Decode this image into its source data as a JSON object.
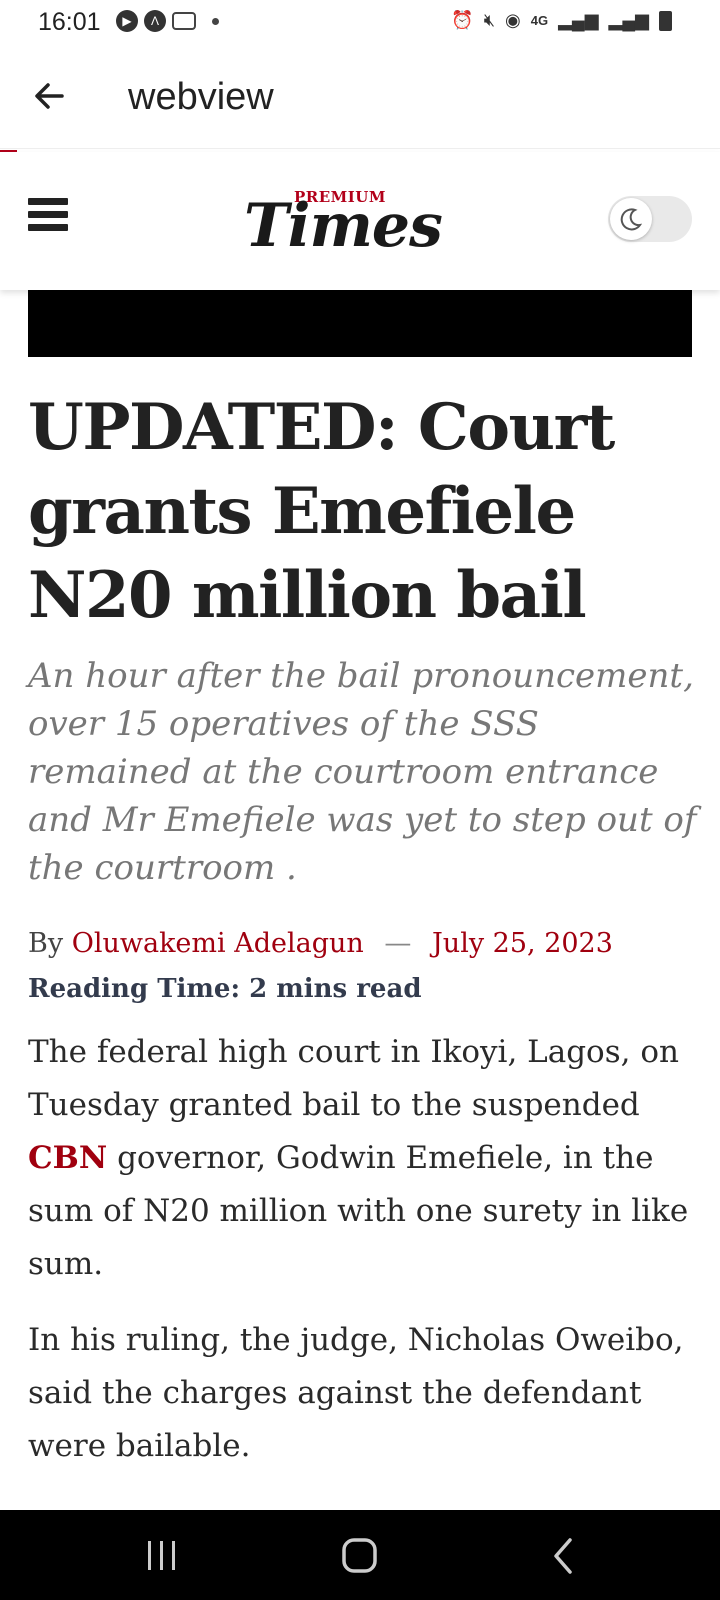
{
  "status_bar": {
    "time": "16:01",
    "network": "4G"
  },
  "app_bar": {
    "title": "webview"
  },
  "site": {
    "logo_premium": "PREMIUM",
    "logo_times": "Times"
  },
  "article": {
    "headline": "UPDATED: Court grants Emefiele N20 million bail",
    "excerpt": "An hour after the bail pronouncement, over 15 operatives of the SSS remained at the courtroom entrance and Mr Emefiele was yet to step out of the courtroom .",
    "byline_prefix": "By",
    "author": "Oluwakemi Adelagun",
    "separator": "—",
    "date": "July 25, 2023",
    "reading_time": "Reading Time: 2 mins read",
    "p1_before": "The federal high court in Ikoyi, Lagos, on Tuesday granted bail to the suspended ",
    "p1_link": "CBN",
    "p1_after": " governor, Godwin Emefiele, in the sum of N20 million with one surety in like sum.",
    "p2": "In his ruling, the judge, Nicholas Oweibo, said the charges against the defendant were bailable."
  },
  "colors": {
    "brand_red": "#a0000f",
    "text_dark": "#222222",
    "excerpt_gray": "#777777"
  }
}
